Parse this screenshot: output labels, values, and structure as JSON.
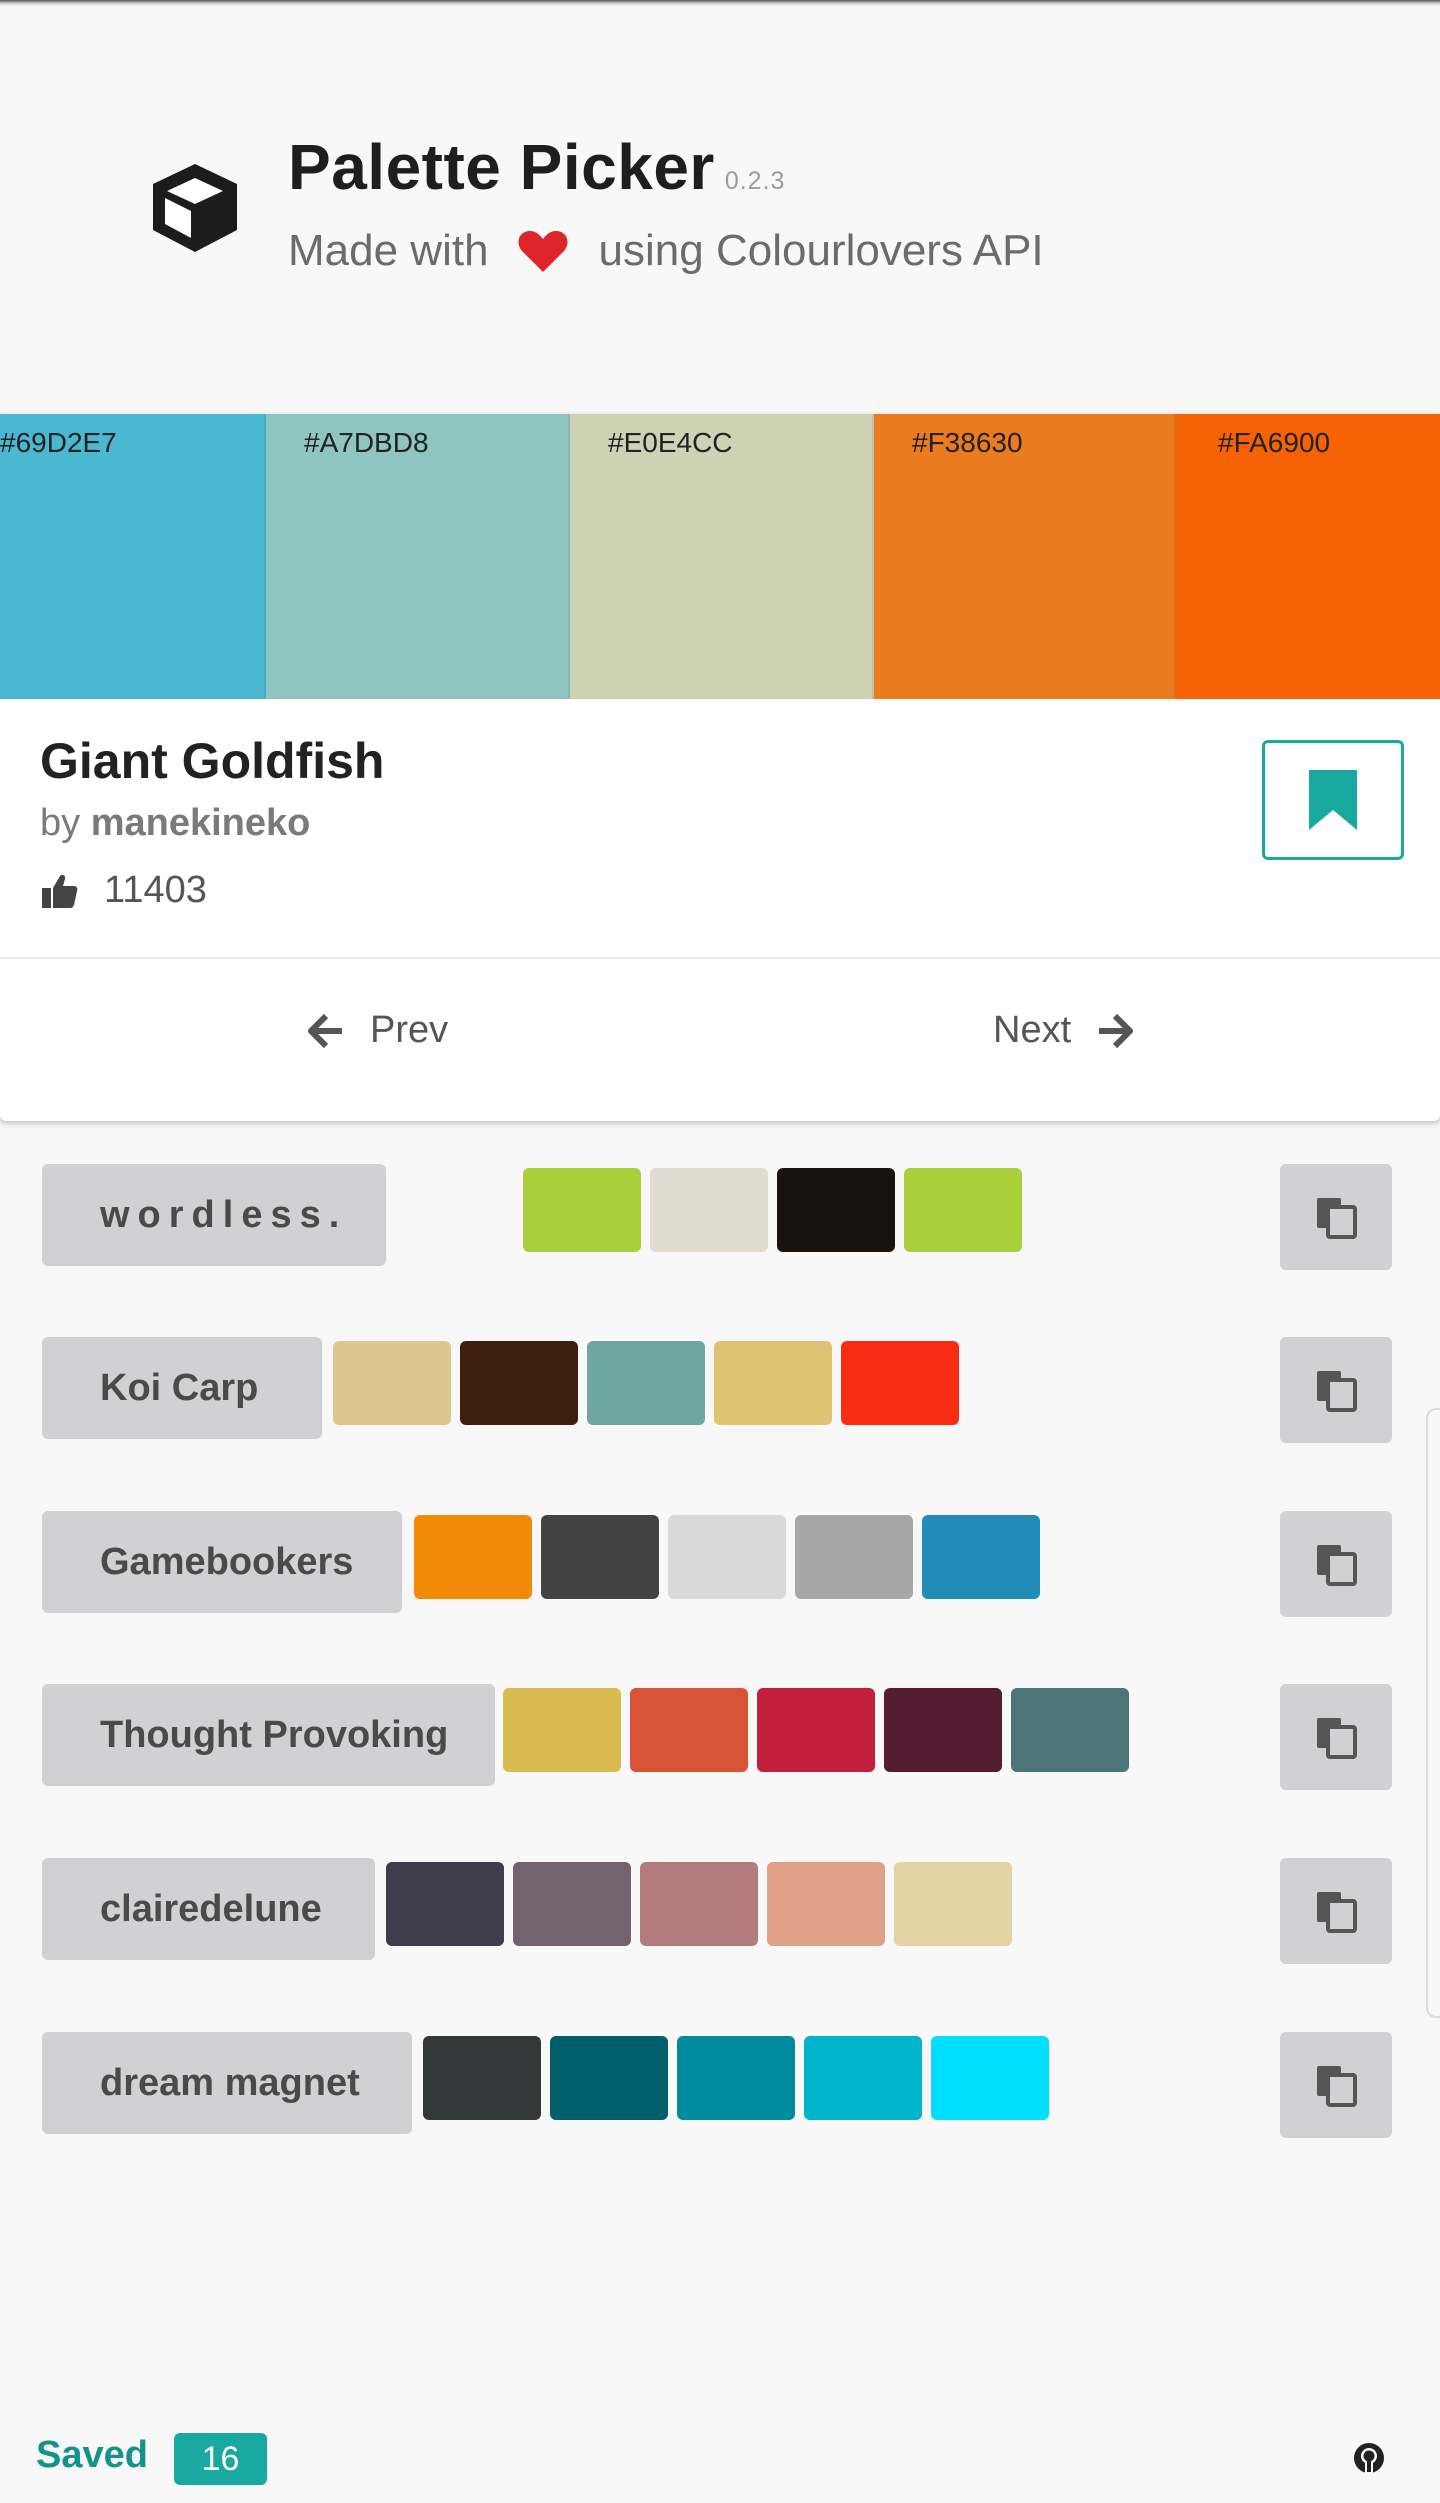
{
  "app": {
    "title": "Palette Picker",
    "version": "0.2.3",
    "tagline_prefix": "Made with",
    "tagline_suffix": "using Colourlovers API",
    "logo_icon": "cube-icon",
    "heart_icon": "heart-icon",
    "heart_color": "#e0242c"
  },
  "current_palette": {
    "title": "Giant Goldfish",
    "author_prefix": "by",
    "author": "manekineko",
    "likes": "11403",
    "colors": [
      {
        "hex": "#69D2E7",
        "label": "#69D2E7",
        "display": "#4ab8d0"
      },
      {
        "hex": "#A7DBD8",
        "label": "#A7DBD8",
        "display": "#8fc5c0"
      },
      {
        "hex": "#E0E4CC",
        "label": "#E0E4CC",
        "display": "#cdd2b5"
      },
      {
        "hex": "#F38630",
        "label": "#F38630",
        "display": "#ea7b1e"
      },
      {
        "hex": "#FA6900",
        "label": "#FA6900",
        "display": "#f76204"
      }
    ],
    "bookmark_icon": "bookmark-icon",
    "bookmark_color": "#1aa9a1"
  },
  "navigation": {
    "prev_label": "Prev",
    "next_label": "Next"
  },
  "palettes": [
    {
      "name": "wordless.",
      "colors": [
        "#a9d03b",
        "#e2dbd2",
        "#1a120d",
        "#a9d03b"
      ]
    },
    {
      "name": "Koi Carp",
      "colors": [
        "#dfc58e",
        "#3e1f0f",
        "#70a6a0",
        "#dfc272",
        "#f82c12"
      ]
    },
    {
      "name": "Gamebookers",
      "colors": [
        "#f08a07",
        "#434343",
        "#d9d9d9",
        "#a6a6a6",
        "#228cb9"
      ]
    },
    {
      "name": "Thought Provoking",
      "colors": [
        "#d9bb50",
        "#d95339",
        "#c21f3c",
        "#541c31",
        "#4b7577"
      ]
    },
    {
      "name": "clairedelune",
      "colors": [
        "#3f3d4b",
        "#73636f",
        "#b27b7e",
        "#e09f87",
        "#e4d3a5"
      ]
    },
    {
      "name": "dream magnet",
      "colors": [
        "#343838",
        "#005f6b",
        "#008c9e",
        "#00b4cc",
        "#00dffc"
      ]
    }
  ],
  "copy_icon": "copy-icon",
  "footer": {
    "saved_label": "Saved",
    "saved_count": "16",
    "github_icon": "github-icon"
  }
}
